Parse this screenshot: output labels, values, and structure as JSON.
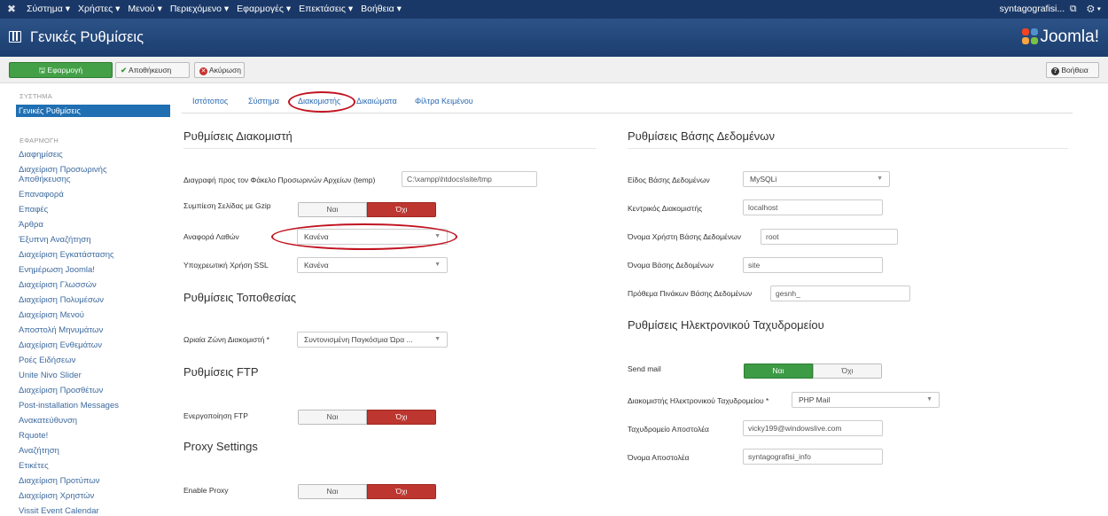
{
  "topnav": {
    "menu": [
      "Σύστημα ▾",
      "Χρήστες ▾",
      "Μενού ▾",
      "Περιεχόμενο ▾",
      "Εφαρμογές ▾",
      "Επεκτάσεις ▾",
      "Βοήθεια ▾"
    ],
    "user": "syntagografisi...",
    "ext_icon": "external-link-icon",
    "gear_icon": "gear-icon"
  },
  "header": {
    "title": "Γενικές Ρυθμίσεις",
    "brand": "Joomla!"
  },
  "toolbar": {
    "apply": "Εφαρμογή",
    "save": "Αποθήκευση",
    "cancel": "Ακύρωση",
    "help": "Βοήθεια"
  },
  "sidebar": {
    "system_heading": "ΣΥΣΤΗΜΑ",
    "active_item": "Γενικές Ρυθμίσεις",
    "app_heading": "ΕΦΑΡΜΟΓΗ",
    "items": [
      "Διαφημίσεις",
      "Διαχείριση Προσωρινής",
      "Αποθήκευσης",
      "Επαναφορά",
      "Επαφές",
      "Άρθρα",
      "Έξυπνη Αναζήτηση",
      "Διαχείριση Εγκατάστασης",
      "Ενημέρωση Joomla!",
      "Διαχείριση Γλωσσών",
      "Διαχείριση Πολυμέσων",
      "Διαχείριση Μενού",
      "Αποστολή Μηνυμάτων",
      "Διαχείριση Ενθεμάτων",
      "Ροές Ειδήσεων",
      "Unite Nivo Slider",
      "Διαχείριση Προσθέτων",
      "Post-installation Messages",
      "Ανακατεύθυνση",
      "Rquote!",
      "Αναζήτηση",
      "Ετικέτες",
      "Διαχείριση Προτύπων",
      "Διαχείριση Χρηστών",
      "Vissit Event Calendar"
    ]
  },
  "tabs": [
    "Ιστότοπος",
    "Σύστημα",
    "Διακομιστής",
    "Δικαιώματα",
    "Φίλτρα Κειμένου"
  ],
  "server": {
    "title": "Ρυθμίσεις Διακομιστή",
    "tmp_label": "Διαγραφή προς τον Φάκελο Προσωρινών Αρχείων (temp)",
    "tmp_value": "C:\\xampp\\htdocs\\site/tmp",
    "gzip_label": "Συμπίεση Σελίδας με Gzip",
    "error_label": "Αναφορά Λαθών",
    "error_value": "Κανένα",
    "ssl_label": "Υποχρεωτική Χρήση SSL",
    "ssl_value": "Κανένα"
  },
  "yes": "Ναι",
  "no": "Όχι",
  "locale": {
    "title": "Ρυθμίσεις Τοποθεσίας",
    "tz_label": "Ωριαία Ζώνη Διακομιστή *",
    "tz_value": "Συντονισμένη Παγκόσμια Ώρα ..."
  },
  "ftp": {
    "title": "Ρυθμίσεις FTP",
    "enable_label": "Ενεργοποίηση FTP"
  },
  "proxy": {
    "title": "Proxy Settings",
    "enable_label": "Enable Proxy"
  },
  "database": {
    "title": "Ρυθμίσεις Βάσης Δεδομένων",
    "type_label": "Είδος Βάσης Δεδομένων",
    "type_value": "MySQLi",
    "host_label": "Κεντρικός Διακομιστής",
    "host_value": "localhost",
    "user_label": "Όνομα Χρήστη Βάσης Δεδομένων",
    "user_value": "root",
    "name_label": "Όνομα Βάσης Δεδομένων",
    "name_value": "site",
    "prefix_label": "Πρόθεμα Πινάκων Βάσης Δεδομένων",
    "prefix_value": "gesnh_"
  },
  "mail": {
    "title": "Ρυθμίσεις Ηλεκτρονικού Ταχυδρομείου",
    "send_label": "Send mail",
    "mailer_label": "Διακομιστής Ηλεκτρονικού Ταχυδρομείου *",
    "mailer_value": "PHP Mail",
    "from_label": "Ταχυδρομείο Αποστολέα",
    "from_value": "vicky199@windowslive.com",
    "fromname_label": "Όνομα Αποστολέα",
    "fromname_value": "syntagografisi_info"
  }
}
